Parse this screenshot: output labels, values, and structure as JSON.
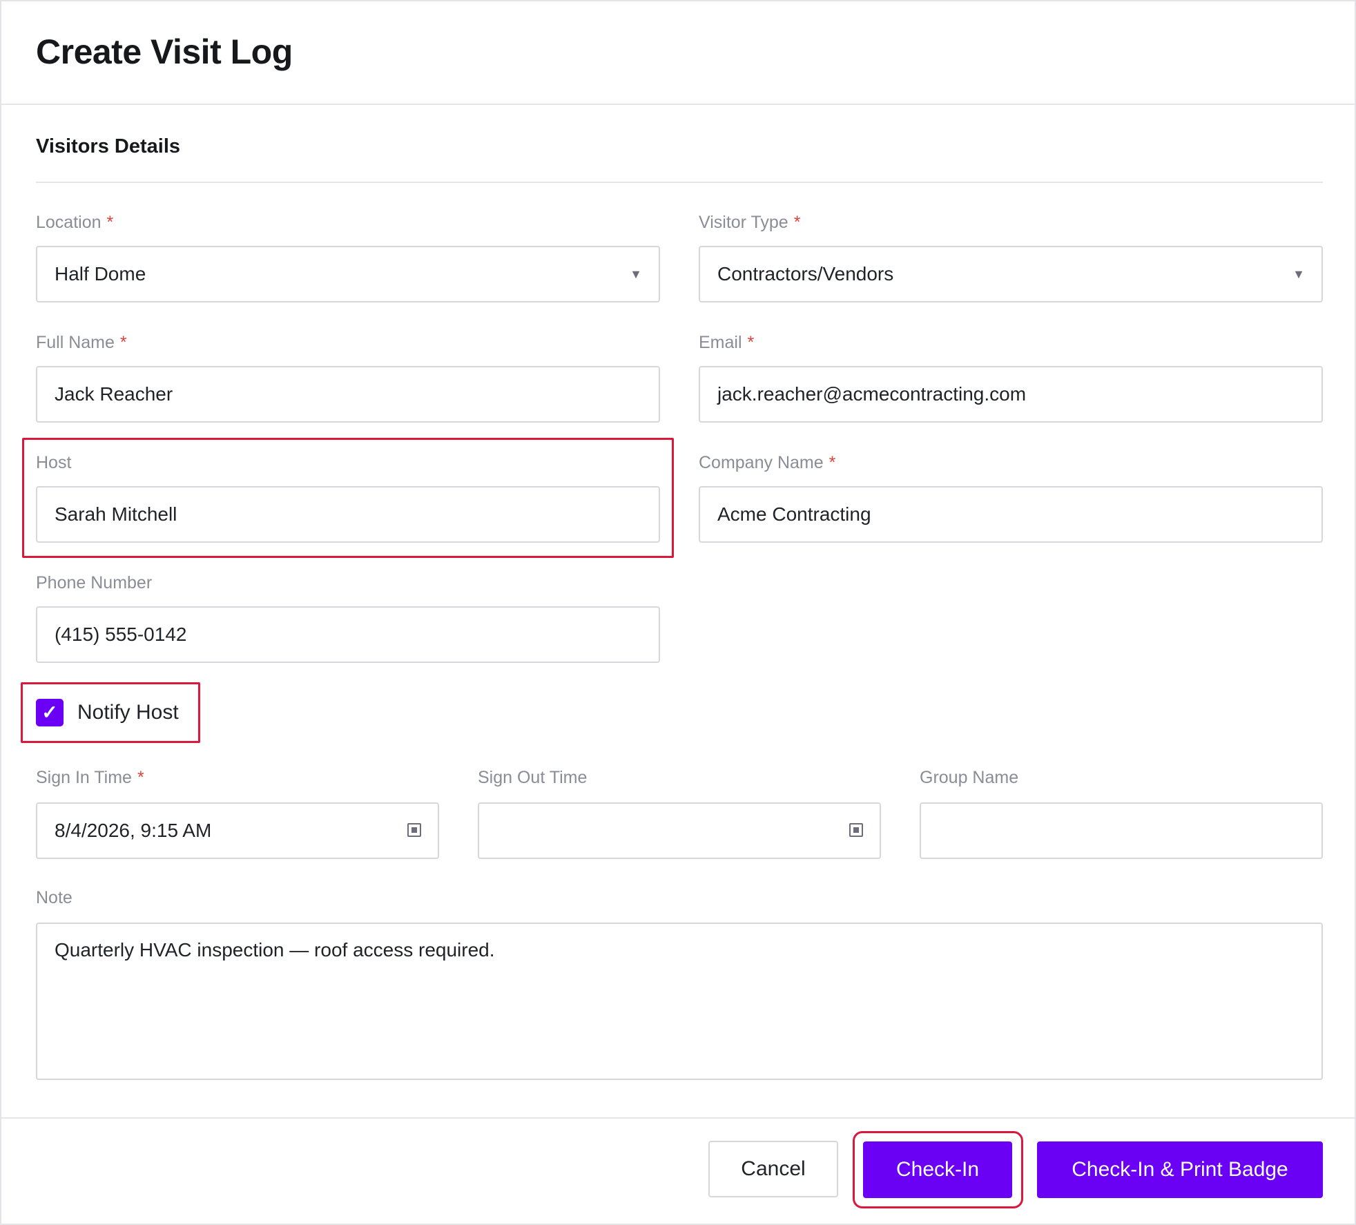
{
  "dialog": {
    "title": "Create Visit Log"
  },
  "section": {
    "title": "Visitors Details"
  },
  "fields": {
    "location": {
      "label": "Location",
      "required": "*",
      "value": "Half Dome"
    },
    "visitor_type": {
      "label": "Visitor Type",
      "required": "*",
      "value": "Contractors/Vendors"
    },
    "full_name": {
      "label": "Full Name",
      "required": "*",
      "value": "Jack Reacher"
    },
    "email": {
      "label": "Email",
      "required": "*",
      "value": "jack.reacher@acmecontracting.com"
    },
    "host": {
      "label": "Host",
      "value": "Sarah Mitchell"
    },
    "company_name": {
      "label": "Company Name",
      "required": "*",
      "value": "Acme Contracting"
    },
    "phone_number": {
      "label": "Phone Number",
      "value": "(415) 555-0142"
    },
    "notify_host": {
      "label": "Notify Host",
      "checked": true,
      "check_glyph": "✓"
    },
    "sign_in_time": {
      "label": "Sign In Time",
      "required": "*",
      "value": "8/4/2026, 9:15 AM"
    },
    "sign_out_time": {
      "label": "Sign Out Time",
      "value": ""
    },
    "group_name": {
      "label": "Group Name",
      "value": ""
    },
    "note": {
      "label": "Note",
      "value": "Quarterly HVAC inspection — roof access required."
    }
  },
  "icons": {
    "dropdown": "caret-down-icon",
    "calendar": "calendar-icon"
  },
  "caret_glyph": "▼",
  "buttons": {
    "cancel": "Cancel",
    "check_in": "Check-In",
    "check_in_print": "Check-In & Print Badge"
  },
  "colors": {
    "accent": "#6a00f4",
    "highlight": "#d9183b",
    "required": "#e0433a"
  }
}
